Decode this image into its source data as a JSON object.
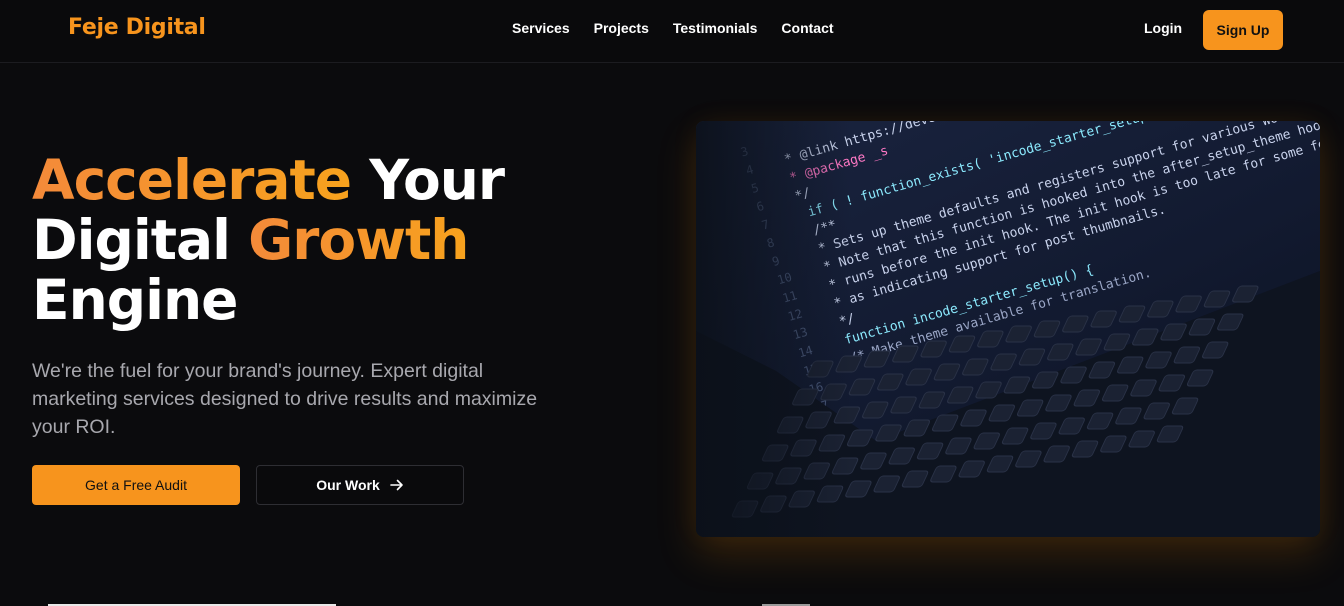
{
  "colors": {
    "accent": "#f7941d",
    "accent_gradient_start": "#f48a3a",
    "accent_gradient_end": "#f7a21d",
    "background": "#0b0b0d",
    "text_muted": "#a8a8ae"
  },
  "nav": {
    "logo": "Feje Digital",
    "links": [
      "Services",
      "Projects",
      "Testimonials",
      "Contact"
    ],
    "login": "Login",
    "signup": "Sign Up"
  },
  "hero": {
    "headline": {
      "line1_accent": "Accelerate",
      "line1_rest": " Your",
      "line2_plain": "Digital ",
      "line2_accent": "Growth",
      "line3": "Engine"
    },
    "subtext": "We're the fuel for your brand's journey. Expert digital marketing services designed to drive results and maximize your ROI.",
    "primary_cta": "Get a Free Audit",
    "secondary_cta": "Our Work",
    "secondary_cta_icon": "arrow-right-icon",
    "image_subject": "laptop-code-photo",
    "code_lines": [
      "* @link https://deve",
      "* @package _s",
      "*/",
      "if ( ! function_exists( 'incode_starter_setup' ) ) :",
      "/**",
      "* Sets up theme defaults and registers support for various WordPress features.",
      "* Note that this function is hooked into the after_setup_theme hook, which",
      "* runs before the init hook. The init hook is too late for some features, such",
      "* as indicating support for post thumbnails.",
      "*/",
      "function incode_starter_setup() {",
      "/* Make theme available for translation."
    ],
    "line_numbers": [
      "3",
      "4",
      "5",
      "6",
      "7",
      "8",
      "9",
      "10",
      "11",
      "12",
      "13",
      "14",
      "15",
      "16",
      "17"
    ]
  }
}
